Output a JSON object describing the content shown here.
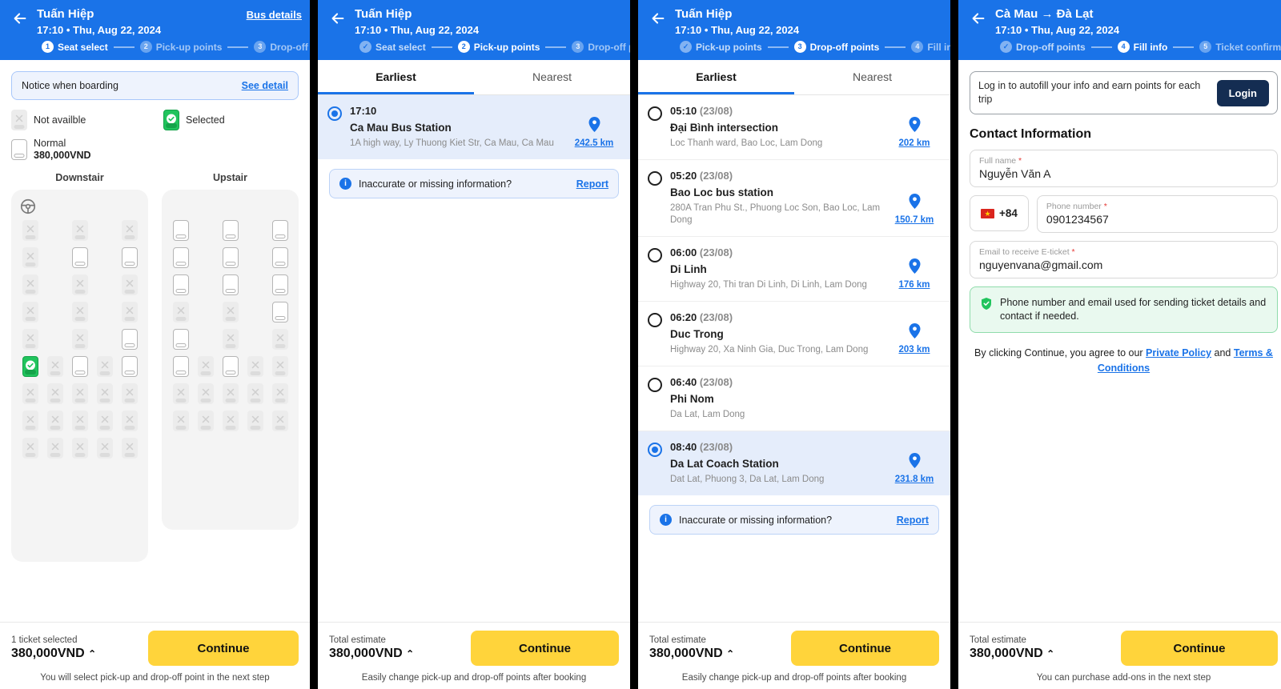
{
  "colors": {
    "brand_blue": "#1a73e8",
    "accent_yellow": "#ffd43b",
    "selected_green": "#21c45d",
    "login_navy": "#142d52",
    "selected_row_bg": "#e5edfb"
  },
  "panels": [
    {
      "id": "seat-select",
      "header": {
        "title": "Tuấn Hiệp",
        "subtitle": "17:10 • Thu, Aug 22, 2024",
        "action_label": "Bus details",
        "back_icon": "arrow-left-icon",
        "steps": [
          {
            "num": "1",
            "label": "Seat select",
            "state": "active"
          },
          {
            "num": "2",
            "label": "Pick-up points",
            "state": "todo"
          },
          {
            "num": "3",
            "label": "Drop-off points",
            "state": "todo"
          }
        ]
      },
      "notice": {
        "text": "Notice when boarding",
        "link": "See detail"
      },
      "legend": {
        "not_available": "Not availble",
        "selected": "Selected",
        "normal": "Normal",
        "normal_price": "380,000VND"
      },
      "decks": [
        {
          "title": "Downstair",
          "has_driver": true,
          "driver_icon": "steering-wheel-icon",
          "rows": [
            [
              "na",
              "",
              "na",
              "",
              "na"
            ],
            [
              "na",
              "",
              "free",
              "",
              "free"
            ],
            [
              "na",
              "",
              "na",
              "",
              "na"
            ],
            [
              "na",
              "",
              "na",
              "",
              "na"
            ],
            [
              "na",
              "",
              "na",
              "",
              "free"
            ],
            [
              "selected",
              "na",
              "free",
              "na",
              "free"
            ],
            [
              "na",
              "na",
              "na",
              "na",
              "na"
            ],
            [
              "na",
              "na",
              "na",
              "na",
              "na"
            ],
            [
              "na",
              "na",
              "na",
              "na",
              "na"
            ]
          ]
        },
        {
          "title": "Upstair",
          "has_driver": false,
          "rows": [
            [
              "free",
              "",
              "free",
              "",
              "free"
            ],
            [
              "free",
              "",
              "free",
              "",
              "free"
            ],
            [
              "free",
              "",
              "free",
              "",
              "free"
            ],
            [
              "na",
              "",
              "na",
              "",
              "free"
            ],
            [
              "free",
              "",
              "na",
              "",
              "na"
            ],
            [
              "free",
              "na",
              "free",
              "na",
              "na"
            ],
            [
              "na",
              "na",
              "na",
              "na",
              "na"
            ],
            [
              "na",
              "na",
              "na",
              "na",
              "na"
            ]
          ]
        }
      ],
      "footer": {
        "caption": "1 ticket selected",
        "price": "380,000VND",
        "caret": "⌃",
        "button": "Continue",
        "note": "You will select pick-up and drop-off point in the next step"
      }
    },
    {
      "id": "pick-up-points",
      "header": {
        "title": "Tuấn Hiệp",
        "subtitle": "17:10 • Thu, Aug 22, 2024",
        "back_icon": "arrow-left-icon",
        "steps": [
          {
            "num": "✓",
            "label": "Seat select",
            "state": "done"
          },
          {
            "num": "2",
            "label": "Pick-up points",
            "state": "active"
          },
          {
            "num": "3",
            "label": "Drop-off points",
            "state": "todo"
          }
        ]
      },
      "tabs": [
        {
          "label": "Earliest",
          "active": true
        },
        {
          "label": "Nearest",
          "active": false
        }
      ],
      "points": [
        {
          "time": "17:10",
          "date": "",
          "name": "Ca Mau Bus Station",
          "address": "1A high way, Ly Thuong Kiet Str, Ca Mau, Ca Mau",
          "distance": "242.5 km",
          "selected": true
        }
      ],
      "report": {
        "text": "Inaccurate or missing information?",
        "link": "Report"
      },
      "footer": {
        "caption": "Total estimate",
        "price": "380,000VND",
        "caret": "⌃",
        "button": "Continue",
        "note": "Easily change pick-up and drop-off points after booking"
      }
    },
    {
      "id": "drop-off-points",
      "header": {
        "title": "Tuấn Hiệp",
        "subtitle": "17:10 • Thu, Aug 22, 2024",
        "back_icon": "arrow-left-icon",
        "steps": [
          {
            "num": "✓",
            "label": "Pick-up points",
            "state": "done"
          },
          {
            "num": "3",
            "label": "Drop-off points",
            "state": "active"
          },
          {
            "num": "4",
            "label": "Fill info",
            "state": "todo"
          }
        ]
      },
      "tabs": [
        {
          "label": "Earliest",
          "active": true
        },
        {
          "label": "Nearest",
          "active": false
        }
      ],
      "points": [
        {
          "time": "05:10",
          "date": "(23/08)",
          "name": "Đại Bình intersection",
          "address": "Loc Thanh ward, Bao Loc, Lam Dong",
          "distance": "202 km",
          "selected": false
        },
        {
          "time": "05:20",
          "date": "(23/08)",
          "name": "Bao Loc bus station",
          "address": "280A Tran Phu St., Phuong Loc Son, Bao Loc, Lam Dong",
          "distance": "150.7 km",
          "selected": false
        },
        {
          "time": "06:00",
          "date": "(23/08)",
          "name": "Di Linh",
          "address": "Highway 20, Thi tran Di Linh, Di Linh, Lam Dong",
          "distance": "176 km",
          "selected": false
        },
        {
          "time": "06:20",
          "date": "(23/08)",
          "name": "Duc Trong",
          "address": "Highway 20, Xa Ninh Gia, Duc Trong, Lam Dong",
          "distance": "203 km",
          "selected": false
        },
        {
          "time": "06:40",
          "date": "(23/08)",
          "name": "Phi Nom",
          "address": "Da Lat, Lam Dong",
          "distance": "",
          "selected": false
        },
        {
          "time": "08:40",
          "date": "(23/08)",
          "name": "Da Lat Coach Station",
          "address": "Dat Lat, Phuong 3, Da Lat, Lam Dong",
          "distance": "231.8 km",
          "selected": true
        }
      ],
      "report": {
        "text": "Inaccurate or missing information?",
        "link": "Report"
      },
      "footer": {
        "caption": "Total estimate",
        "price": "380,000VND",
        "caret": "⌃",
        "button": "Continue",
        "note": "Easily change pick-up and drop-off points after booking"
      }
    },
    {
      "id": "fill-info",
      "header": {
        "title": "Cà Mau → Đà Lạt",
        "subtitle": "17:10 • Thu, Aug 22, 2024",
        "back_icon": "arrow-left-icon",
        "steps": [
          {
            "num": "✓",
            "label": "Drop-off points",
            "state": "done"
          },
          {
            "num": "4",
            "label": "Fill info",
            "state": "active"
          },
          {
            "num": "5",
            "label": "Ticket confirmation",
            "state": "todo"
          }
        ]
      },
      "login": {
        "text": "Log in to autofill your info and earn points for each trip",
        "button": "Login"
      },
      "section_title": "Contact Information",
      "fields": {
        "full_name": {
          "label": "Full name",
          "required": "*",
          "value": "Nguyễn Văn A"
        },
        "country_code": {
          "value": "+84",
          "flag": "vietnam-flag-icon"
        },
        "phone": {
          "label": "Phone number",
          "required": "*",
          "value": "0901234567"
        },
        "email": {
          "label": "Email to receive E-ticket",
          "required": "*",
          "value": "nguyenvana@gmail.com"
        }
      },
      "tip": {
        "icon": "shield-check-icon",
        "text": "Phone number and email used for sending ticket details and contact if needed."
      },
      "terms": {
        "prefix": "By clicking Continue, you agree to our ",
        "link1": "Private Policy",
        "middle": " and ",
        "link2": "Terms & Conditions"
      },
      "footer": {
        "caption": "Total estimate",
        "price": "380,000VND",
        "caret": "⌃",
        "button": "Continue",
        "note": "You can purchase add-ons in the next step"
      }
    }
  ]
}
